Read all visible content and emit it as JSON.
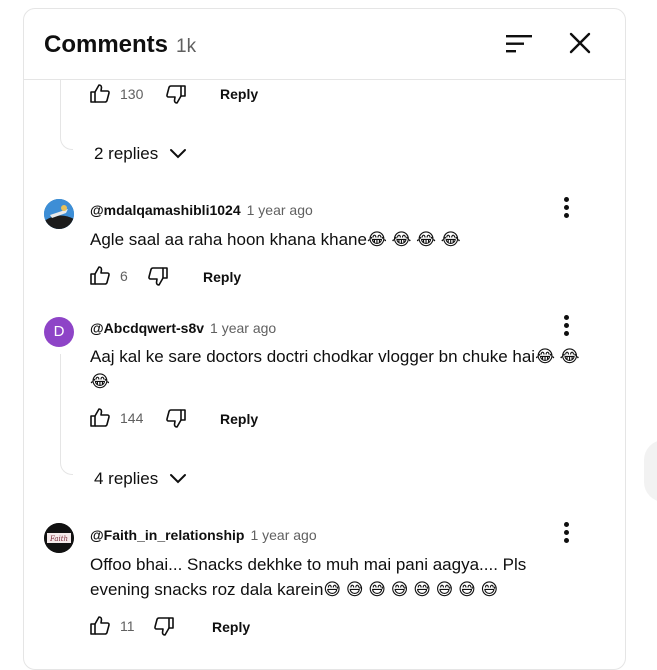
{
  "header": {
    "title": "Comments",
    "count": "1k"
  },
  "top_actions": {
    "likes": "130",
    "reply": "Reply"
  },
  "replies_toggle_1": {
    "label": "2 replies"
  },
  "comments": [
    {
      "author": "@mdalqamashibli1024",
      "time": "1 year ago",
      "text": "Agle saal aa raha hoon khana khane😂 😂 😂 😂",
      "likes": "6",
      "reply": "Reply"
    },
    {
      "author": "@Abcdqwert-s8v",
      "avatar_letter": "D",
      "avatar_color": "#8e44c7",
      "time": "1 year ago",
      "text": "Aaj kal ke sare doctors doctri chodkar vlogger bn chuke hai😂 😂 😂",
      "likes": "144",
      "reply": "Reply"
    },
    {
      "author": "@Faith_in_relationship",
      "avatar_text": "Faith",
      "time": "1 year ago",
      "text": "Offoo bhai... Snacks dekhke to muh mai pani aagya.... Pls evening snacks roz dala karein😅 😅 😅 😅 😅 😅 😅 😅",
      "likes": "11",
      "reply": "Reply"
    }
  ],
  "replies_toggle_2": {
    "label": "4 replies"
  }
}
